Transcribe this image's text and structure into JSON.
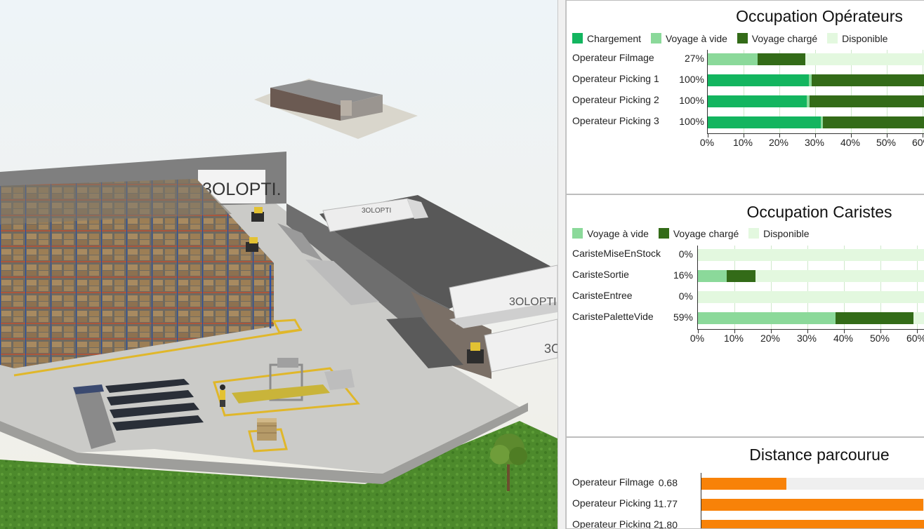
{
  "scene": {
    "brand_text": "3OLOPTI.",
    "truck_brand_1": "3OLOPTI",
    "truck_brand_2": "3OLOPTI.",
    "truck_brand_3": "3O"
  },
  "colors": {
    "chargement": "#13b55f",
    "voyage_vide": "#8bd99a",
    "voyage_charge": "#336b18",
    "disponible": "#e3f8df",
    "distance": "#f88208"
  },
  "operators_panel": {
    "title": "Occupation Opérateurs",
    "legend": [
      "Chargement",
      "Voyage à vide",
      "Voyage chargé",
      "Disponible"
    ],
    "rows": [
      {
        "label": "Operateur Filmage",
        "value": "27%",
        "segments": [
          0,
          13.9,
          13.4
        ]
      },
      {
        "label": "Operateur Picking 1",
        "value": "100%",
        "segments": [
          28.2,
          0.8,
          71.0
        ]
      },
      {
        "label": "Operateur Picking 2",
        "value": "100%",
        "segments": [
          27.7,
          0.8,
          71.5
        ]
      },
      {
        "label": "Operateur Picking 3",
        "value": "100%",
        "segments": [
          31.5,
          0.6,
          67.9
        ]
      }
    ],
    "ticks": [
      "0%",
      "10%",
      "20%",
      "30%",
      "40%",
      "50%",
      "60%"
    ]
  },
  "caristes_panel": {
    "title": "Occupation Caristes",
    "legend": [
      "Voyage à vide",
      "Voyage chargé",
      "Disponible"
    ],
    "rows": [
      {
        "label": "CaristeMiseEnStock",
        "value": "0%",
        "segments": [
          0,
          0
        ]
      },
      {
        "label": "CaristeSortie",
        "value": "16%",
        "segments": [
          7.8,
          8.0
        ]
      },
      {
        "label": "CaristeEntree",
        "value": "0%",
        "segments": [
          0,
          0
        ]
      },
      {
        "label": "CaristePaletteVide",
        "value": "59%",
        "segments": [
          37.6,
          21.4
        ]
      }
    ],
    "ticks": [
      "0%",
      "10%",
      "20%",
      "30%",
      "40%",
      "50%",
      "60%"
    ]
  },
  "distance_panel": {
    "title": "Distance parcourue",
    "rows": [
      {
        "label": "Operateur Filmage",
        "value": "0.68"
      },
      {
        "label": "Operateur Picking 1",
        "value": "1.77"
      },
      {
        "label": "Operateur Picking 2",
        "value": "1.80"
      }
    ],
    "scale_max": 1.85
  }
}
